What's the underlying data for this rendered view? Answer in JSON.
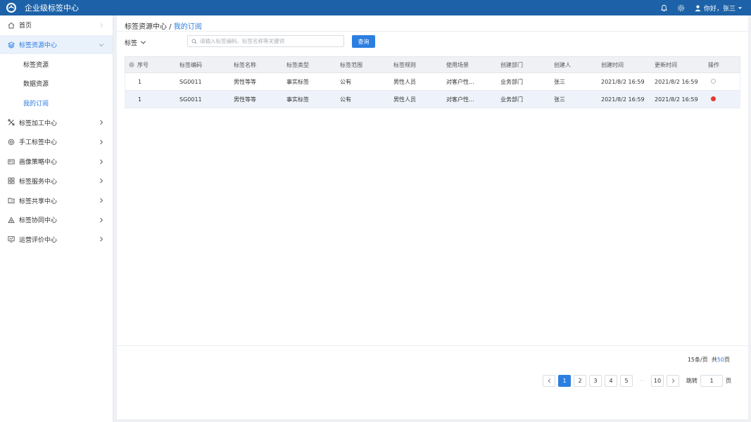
{
  "app": {
    "title": "企业级标签中心"
  },
  "header": {
    "greeting": "你好，张三"
  },
  "sidebar": {
    "items": [
      {
        "label": "首页",
        "icon": "home-icon"
      },
      {
        "label": "标签资源中心",
        "icon": "layers-icon",
        "active": true,
        "children": [
          {
            "label": "标签资源"
          },
          {
            "label": "数据资源"
          },
          {
            "label": "我的订阅",
            "selected": true
          }
        ]
      },
      {
        "label": "标签加工中心",
        "icon": "tools-icon"
      },
      {
        "label": "手工标签中心",
        "icon": "settings-icon"
      },
      {
        "label": "画像策略中心",
        "icon": "id-card-icon"
      },
      {
        "label": "标签服务中心",
        "icon": "grid-icon"
      },
      {
        "label": "标签共享中心",
        "icon": "folder-share-icon"
      },
      {
        "label": "标签协同中心",
        "icon": "triangle-icon"
      },
      {
        "label": "运营评价中心",
        "icon": "monitor-icon"
      }
    ]
  },
  "breadcrumb": {
    "parent": "标签资源中心",
    "sep": " / ",
    "current": "我的订阅"
  },
  "toolbar": {
    "filter_label": "标签",
    "search_placeholder": "请输入标签编码、标签名称等关键词",
    "query_button": "查询"
  },
  "table": {
    "columns": [
      "序号",
      "标签编码",
      "标签名称",
      "标签类型",
      "标签范围",
      "标签规则",
      "使用场景",
      "创建部门",
      "创建人",
      "创建时间",
      "更新时间",
      "操作"
    ],
    "rows": [
      {
        "cells": [
          "1",
          "SG0011",
          "男性等等",
          "事实标签",
          "公有",
          "男性人员",
          "对客户性...",
          "业务部门",
          "张三",
          "2021/8/2 16:59",
          "2021/8/2 16:59"
        ],
        "status": "off"
      },
      {
        "cells": [
          "1",
          "SG0011",
          "男性等等",
          "事实标签",
          "公有",
          "男性人员",
          "对客户性...",
          "业务部门",
          "张三",
          "2021/8/2 16:59",
          "2021/8/2 16:59"
        ],
        "status": "on"
      }
    ]
  },
  "pagination": {
    "per_page": "15条/页",
    "total_prefix": "共",
    "total_pages": "50",
    "total_suffix": "页",
    "pages": [
      "1",
      "2",
      "3",
      "4",
      "5"
    ],
    "ellipsis": "···",
    "last_page": "10",
    "jump_label": "跳转",
    "jump_value": "1",
    "jump_suffix": "页"
  },
  "colors": {
    "header": "#1d62a8",
    "accent": "#2c7fe1",
    "status_on": "#e23b2e"
  }
}
